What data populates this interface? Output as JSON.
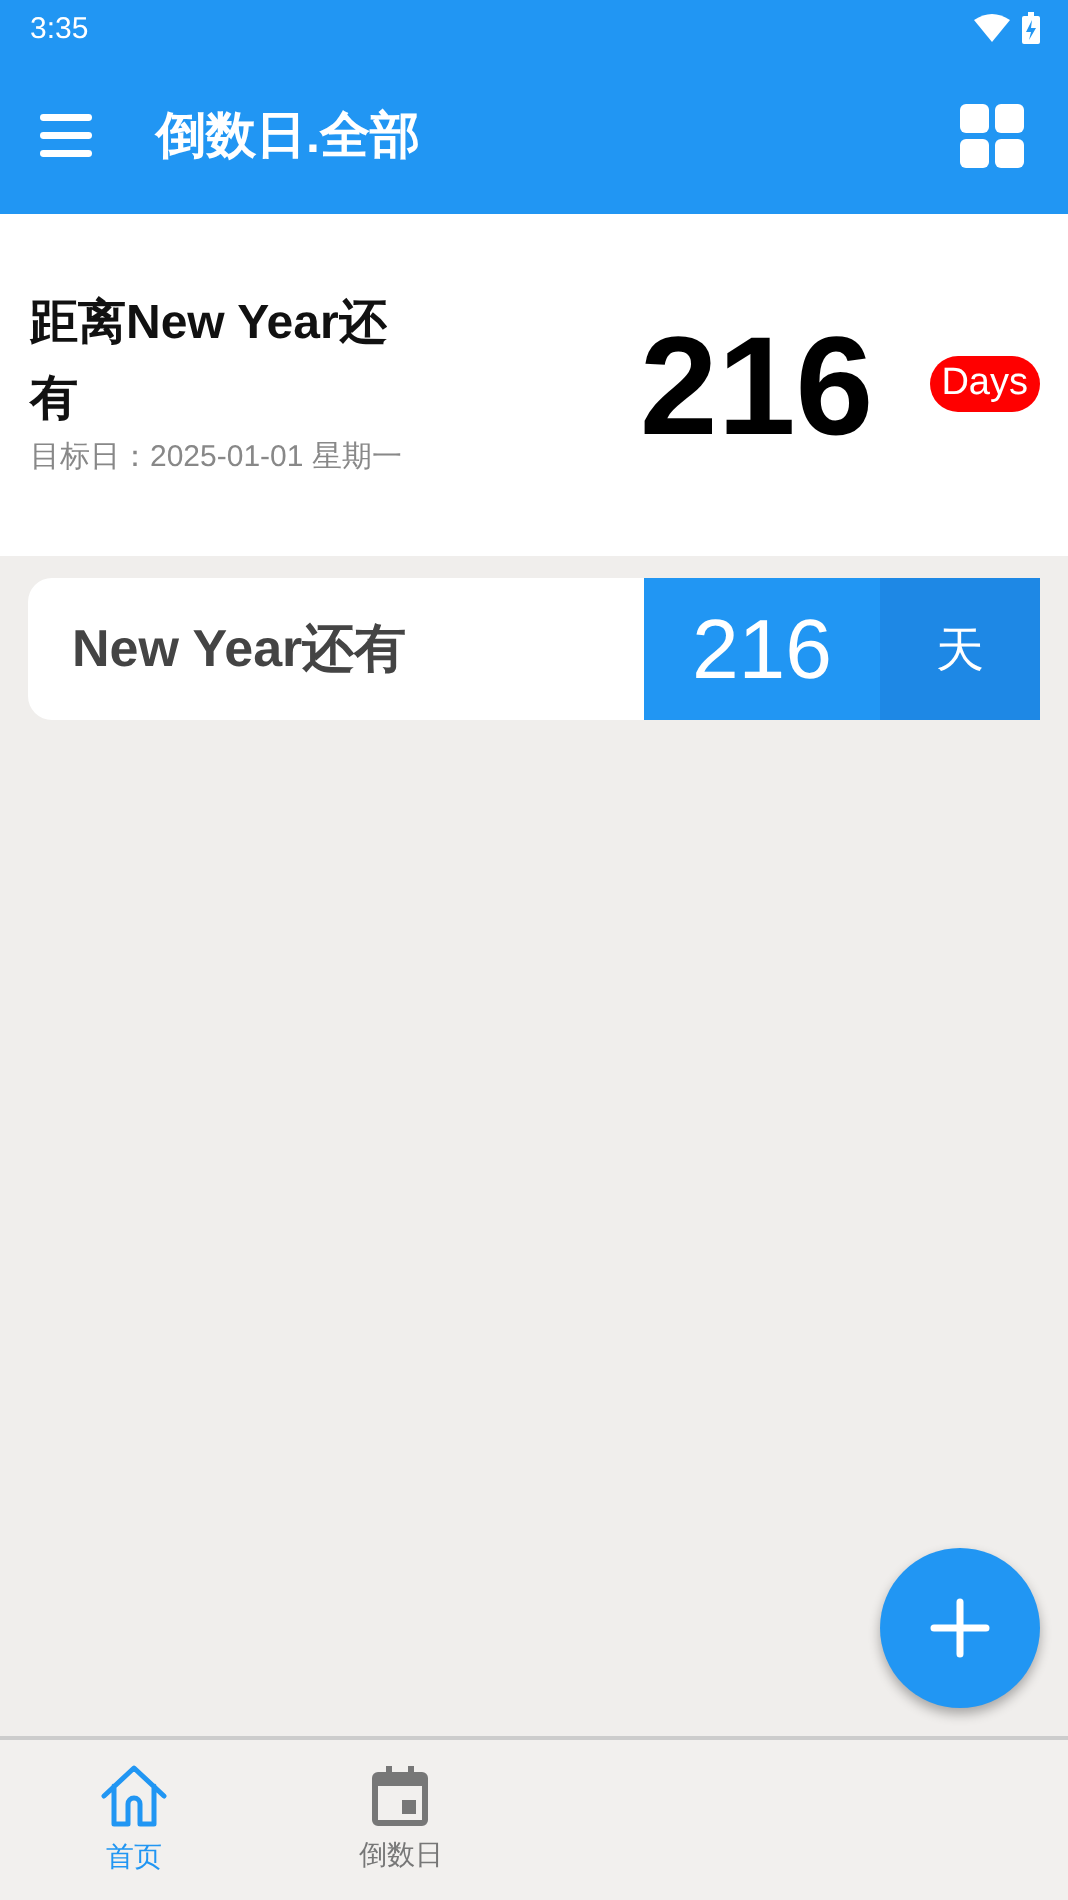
{
  "status_bar": {
    "time": "3:35"
  },
  "app_bar": {
    "title": "倒数日.全部"
  },
  "featured": {
    "title": "距离New Year还有",
    "target_date": "目标日：2025-01-01 星期一",
    "count": "216",
    "unit": "Days"
  },
  "events": [
    {
      "title": "New Year还有",
      "count": "216",
      "unit": "天"
    }
  ],
  "bottom_nav": [
    {
      "label": "首页",
      "kind": "home",
      "selected": true
    },
    {
      "label": "倒数日",
      "kind": "calendar",
      "selected": false
    }
  ]
}
